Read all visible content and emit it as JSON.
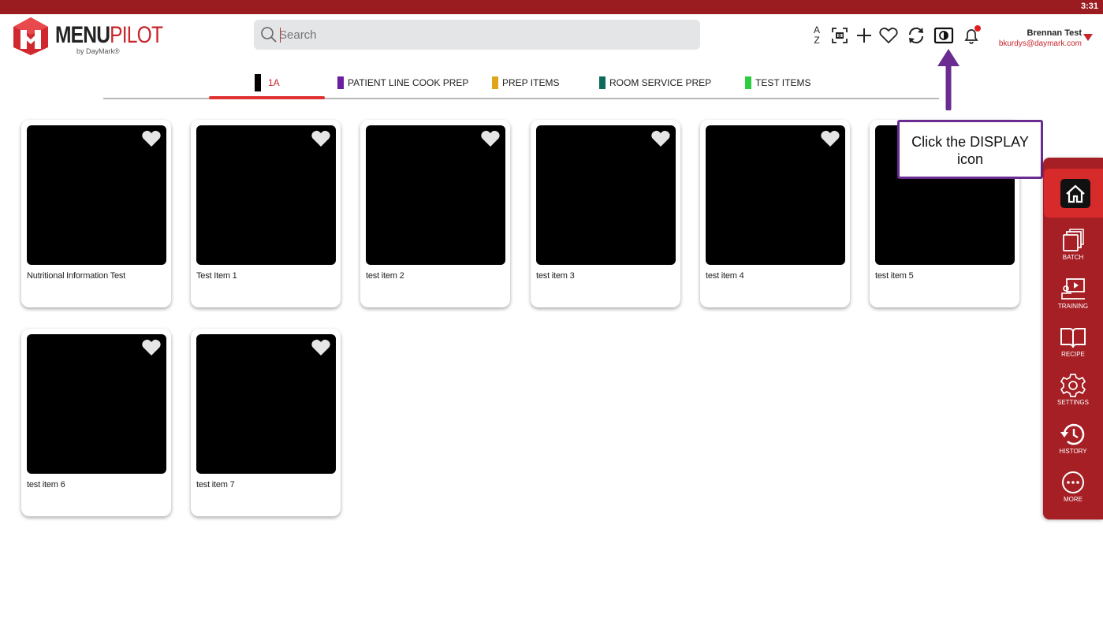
{
  "status_bar": {
    "time": "3:31"
  },
  "logo": {
    "brand_main": "MENU",
    "brand_pilot": "PILOT",
    "tagline": "by DayMark®"
  },
  "search": {
    "placeholder": "Search"
  },
  "toolbar": {
    "sort_top": "A",
    "sort_bottom": "Z",
    "icons": [
      "sort-az-icon",
      "scan-icon",
      "add-icon",
      "favorite-icon",
      "sync-icon",
      "display-icon",
      "notification-bell-icon"
    ]
  },
  "user": {
    "name": "Brennan Test",
    "email": "bkurdys@daymark.com"
  },
  "tabs": [
    {
      "label": "1A",
      "color": "#000000",
      "active": true
    },
    {
      "label": "PATIENT LINE COOK PREP",
      "color": "#6a1fa0"
    },
    {
      "label": "PREP ITEMS",
      "color": "#e0a619"
    },
    {
      "label": "ROOM SERVICE PREP",
      "color": "#0d6b5a"
    },
    {
      "label": "TEST ITEMS",
      "color": "#2ecc40"
    }
  ],
  "items": [
    {
      "name": "Nutritional Information Test"
    },
    {
      "name": "Test Item 1"
    },
    {
      "name": "test item 2"
    },
    {
      "name": "test item 3"
    },
    {
      "name": "test item 4"
    },
    {
      "name": "test item 5"
    },
    {
      "name": "test item 6"
    },
    {
      "name": "test item 7"
    }
  ],
  "callout": {
    "text": "Click the DISPLAY icon"
  },
  "sidenav": {
    "items": [
      {
        "label": "BATCH",
        "icon": "batch-icon"
      },
      {
        "label": "TRAINING",
        "icon": "training-icon"
      },
      {
        "label": "RECIPE",
        "icon": "recipe-book-icon"
      },
      {
        "label": "SETTINGS",
        "icon": "settings-gear-icon"
      },
      {
        "label": "HISTORY",
        "icon": "history-icon"
      },
      {
        "label": "MORE",
        "icon": "more-icon"
      }
    ]
  },
  "colors": {
    "brand_red": "#9b1c20",
    "accent_red": "#c8242a",
    "callout_purple": "#6a2c91"
  }
}
